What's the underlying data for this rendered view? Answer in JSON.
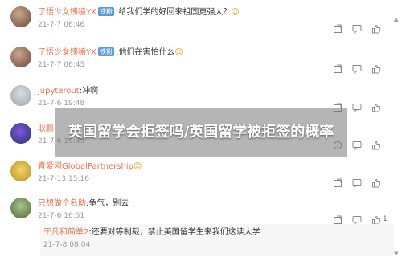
{
  "comments": [
    {
      "username": "了悟少女姨嗑YX",
      "badge": "铁粉",
      "text": ":给我们学的好回来祖国更强大？",
      "emoji": "😉",
      "time": "21-7-7 06:46",
      "likes": ""
    },
    {
      "username": "了悟少女姨嗑YX",
      "badge": "铁粉",
      "text": ":他们在害怕什么",
      "emoji": "😉",
      "time": "21-7-7 06:45",
      "likes": ""
    },
    {
      "username": "jupyterout",
      "badge": "",
      "text": ":冲啊",
      "emoji": "",
      "time": "21-7-6 19:48",
      "likes": ""
    },
    {
      "username": "耿鹏",
      "badge": "",
      "text": "",
      "emoji": "",
      "time": "21-7-6 19:35",
      "likes": ""
    },
    {
      "username": "青爱网GlobalPartnership",
      "badge": "",
      "text": "",
      "emoji": "😉",
      "time": "21-7-13 15:16",
      "likes": ""
    },
    {
      "username": "只想做个名助",
      "badge": "",
      "text": ":争气，别去",
      "emoji": "",
      "time": "21-7-6 16:51",
      "likes": "1"
    }
  ],
  "reply": {
    "username": "干凡和简单2",
    "text": ":还要对等制裁，禁止美国留学生来我们这读大学",
    "time": "21-7-8 08:04"
  },
  "overlay": {
    "title": "英国留学会拒签吗/英国留学被拒签的概率"
  },
  "colors": {
    "username": "#eb7350",
    "badge": "#5a9bdc",
    "time": "#999999"
  },
  "icons": {
    "repost": "repost-icon",
    "comment": "comment-icon",
    "like": "thumbs-up-icon"
  }
}
